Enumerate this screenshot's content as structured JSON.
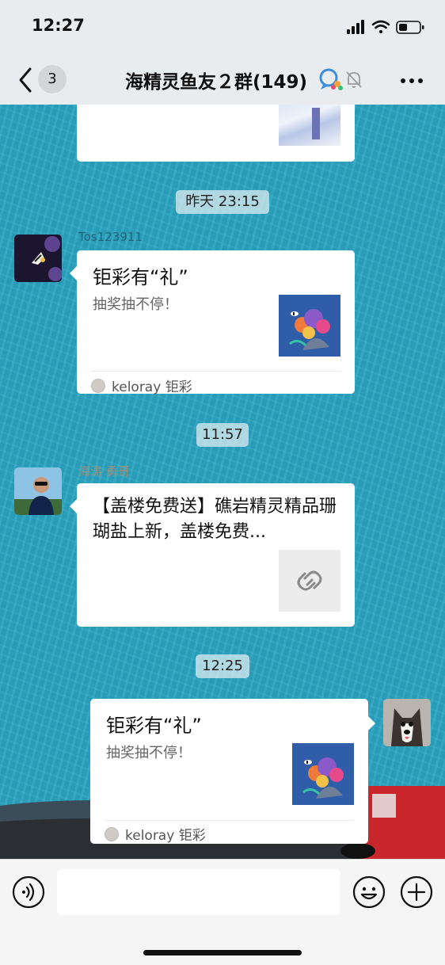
{
  "status": {
    "time": "12:27"
  },
  "nav": {
    "back_count": "3",
    "title": "海精灵鱼友２群(149)"
  },
  "messages": {
    "ts1": "昨天 23:15",
    "ts2": "11:57",
    "ts3": "12:25",
    "m1": {
      "sender": "Tos123911",
      "title": "钜彩有“礼”",
      "subtitle": "抽奖抽不停！",
      "source": "keloray 钜彩"
    },
    "m2": {
      "sender": "海涛 勇哥",
      "text": "【盖楼免费送】礁岩精灵精品珊瑚盐上新，盖楼免费..."
    },
    "m3": {
      "title": "钜彩有“礼”",
      "subtitle": "抽奖抽不停！",
      "source": "keloray 钜彩"
    }
  },
  "icons": {
    "back": "chevron-left-icon",
    "more": "more-dots-icon",
    "mute": "bell-muted-icon",
    "voice": "voice-icon",
    "emoji": "emoji-icon",
    "plus": "plus-circle-icon",
    "link": "link-icon"
  },
  "colors": {
    "chat_bg": "#2aa4c1",
    "bar_bg": "#e9ecef",
    "card_bg": "#ffffff"
  }
}
